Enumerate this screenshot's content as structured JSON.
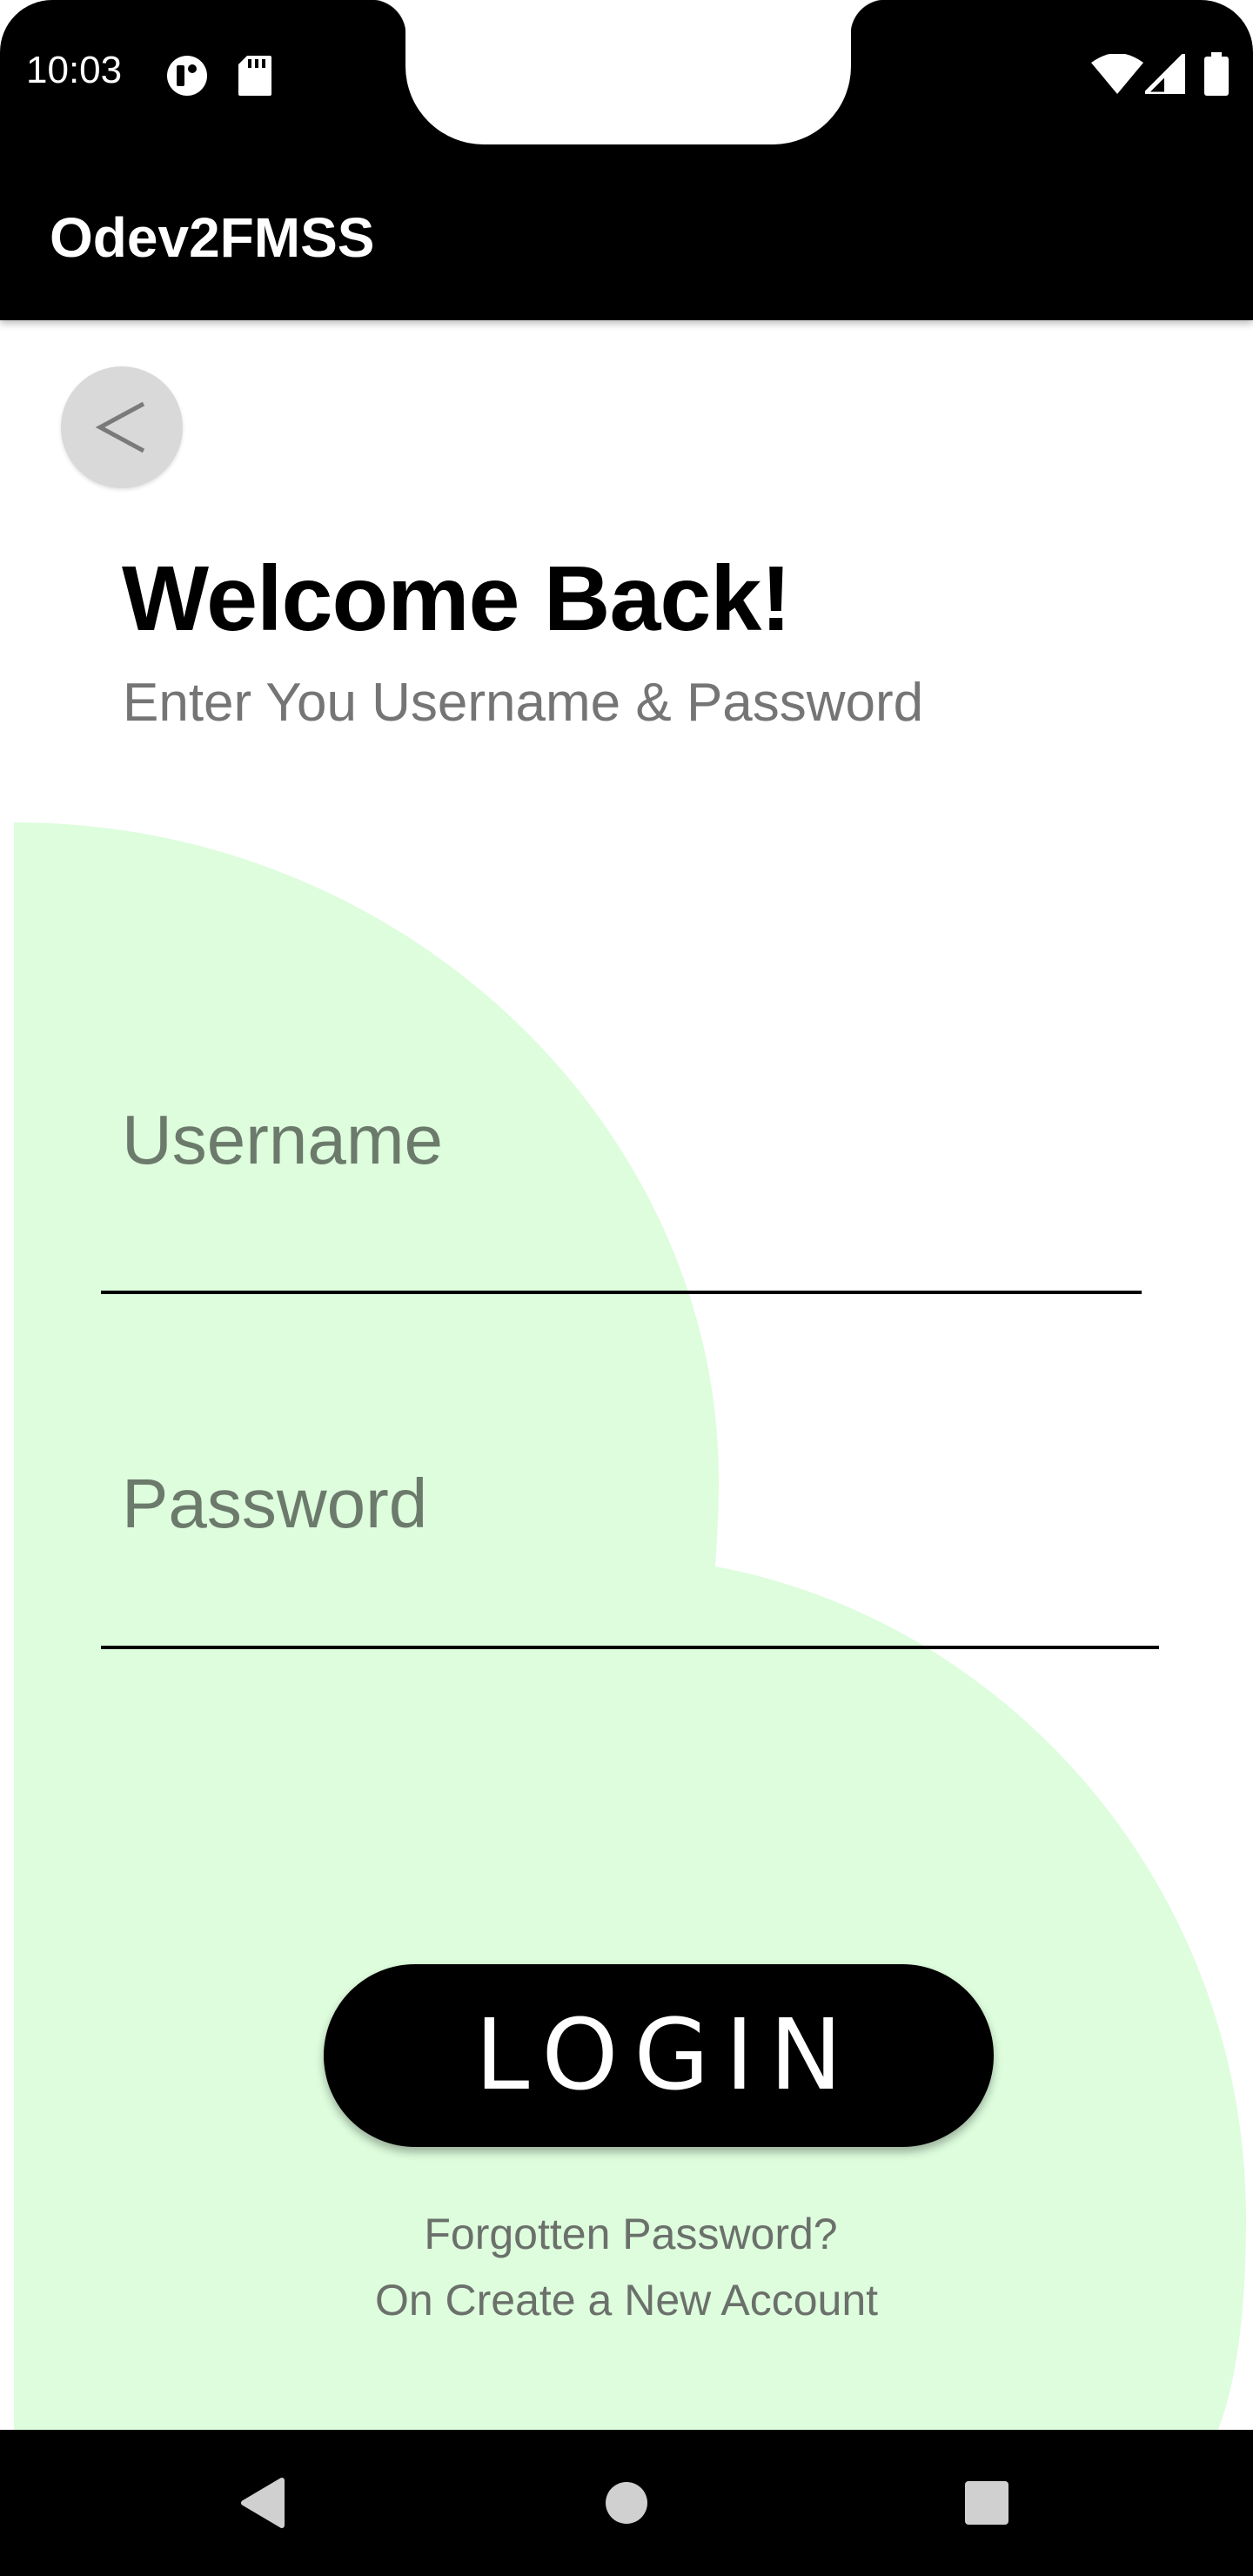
{
  "status_bar": {
    "time": "10:03",
    "left_icons": [
      "notification-icon",
      "sd-card-icon"
    ],
    "right_icons": [
      "wifi-icon",
      "cellular-signal-icon",
      "battery-icon"
    ]
  },
  "app_bar": {
    "title": "Odev2FMSS"
  },
  "header": {
    "back_icon": "chevron-left-icon",
    "title": "Welcome Back!",
    "subtitle": "Enter You Username & Password"
  },
  "form": {
    "username": {
      "value": "",
      "placeholder": "Username"
    },
    "password": {
      "value": "",
      "placeholder": "Password"
    },
    "login_label": "LOGIN",
    "forgot_label": "Forgotten Password?",
    "create_label": "On Create a New Account"
  },
  "nav_bar": {
    "icons": [
      "nav-back-icon",
      "nav-home-icon",
      "nav-recents-icon"
    ]
  },
  "colors": {
    "accent_black": "#000000",
    "blob_green": "#ddfddd",
    "subtitle_gray": "#757575",
    "placeholder_gray": "#6c7a6c",
    "back_button_gray": "#d9d9d9"
  }
}
